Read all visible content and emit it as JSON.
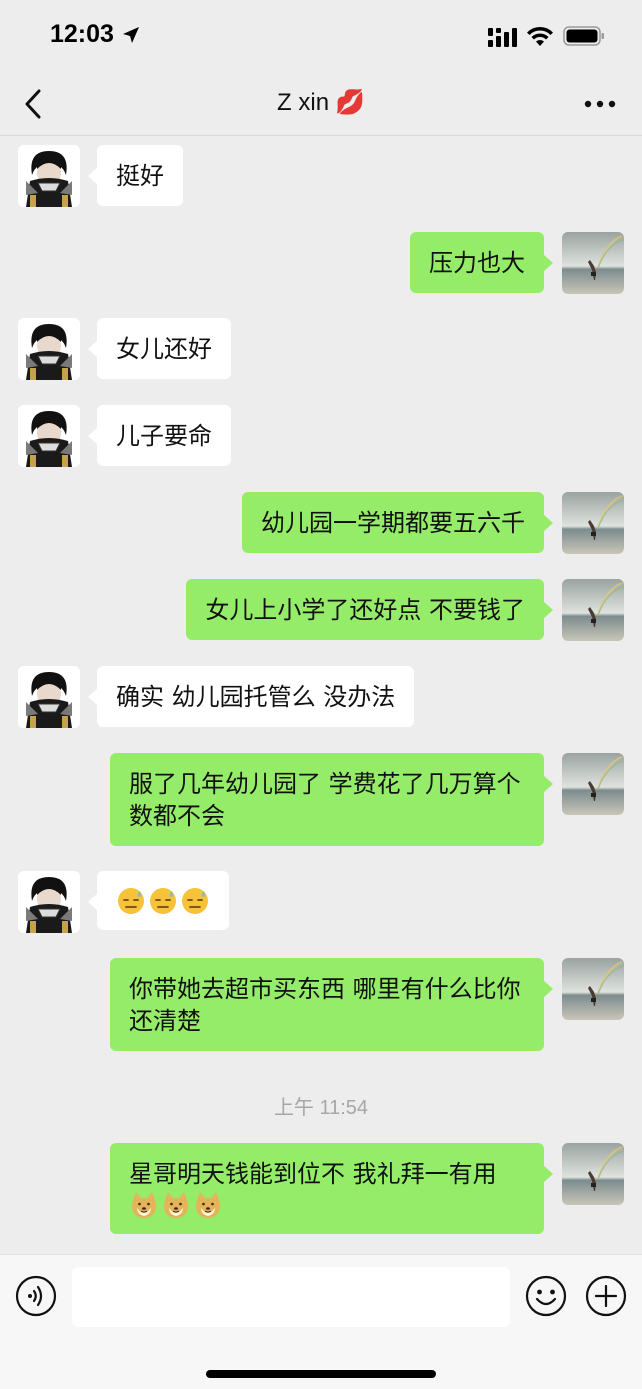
{
  "status_bar": {
    "time": "12:03"
  },
  "nav": {
    "title": "Z xin",
    "title_emoji": "💋"
  },
  "messages": [
    {
      "side": "left",
      "text": "挺好"
    },
    {
      "side": "right",
      "text": "压力也大"
    },
    {
      "side": "left",
      "text": "女儿还好"
    },
    {
      "side": "left",
      "text": "儿子要命"
    },
    {
      "side": "right",
      "text": "幼儿园一学期都要五六千"
    },
    {
      "side": "right",
      "text": "女儿上小学了还好点 不要钱了"
    },
    {
      "side": "left",
      "text": "确实 幼儿园托管么 没办法"
    },
    {
      "side": "right",
      "text": "服了几年幼儿园了 学费花了几万算个数都不会"
    },
    {
      "side": "left",
      "emojis": [
        "sweat-face",
        "sweat-face",
        "sweat-face"
      ]
    },
    {
      "side": "right",
      "text": "你带她去超市买东西 哪里有什么比你还清楚"
    },
    {
      "side": "right",
      "text": "星哥明天钱能到位不 我礼拜一有用",
      "emojis": [
        "doge",
        "doge",
        "doge"
      ]
    }
  ],
  "timestamp": "上午 11:54",
  "input": {
    "value": "",
    "placeholder": ""
  },
  "colors": {
    "self_bubble": "#95ec69",
    "other_bubble": "#ffffff",
    "background": "#ededed"
  },
  "icons": [
    "location-arrow-icon",
    "signal-icon",
    "wifi-icon",
    "battery-icon",
    "back-chevron-icon",
    "more-icon",
    "voice-icon",
    "emoji-icon",
    "plus-icon"
  ]
}
